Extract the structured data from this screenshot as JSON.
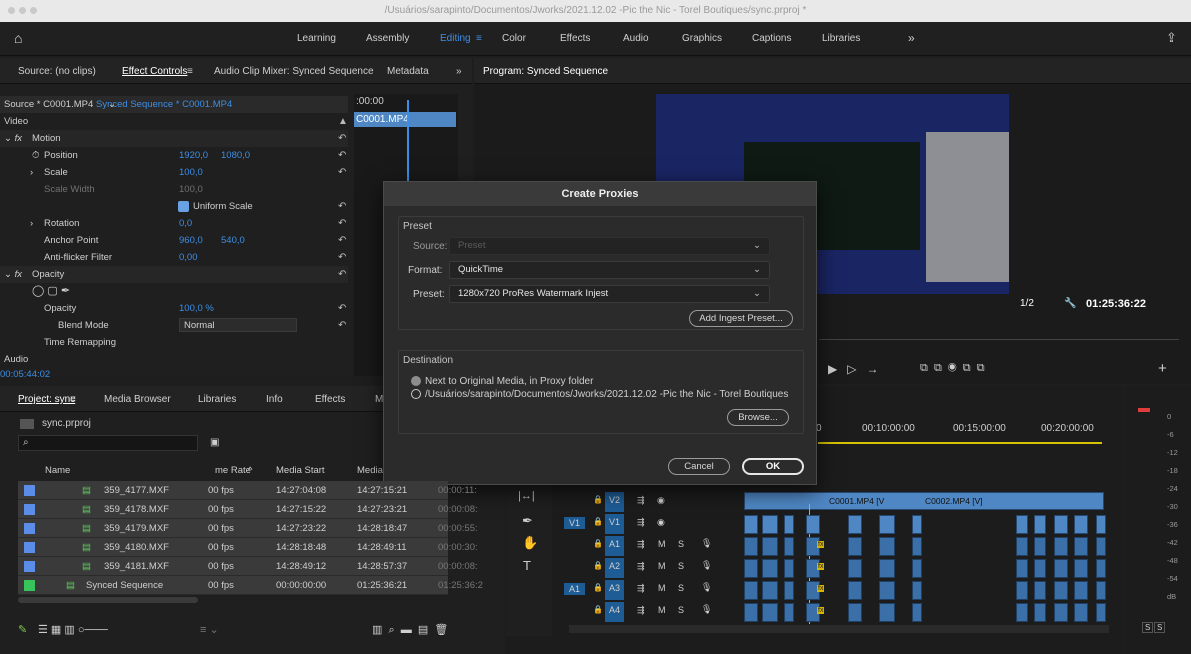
{
  "window": {
    "title": "/Usuários/sarapinto/Documentos/Jworks/2021.12.02 -Pic the Nic - Torel Boutiques/sync.prproj *"
  },
  "workspaces": {
    "items": [
      "Learning",
      "Assembly",
      "Editing",
      "Color",
      "Effects",
      "Audio",
      "Graphics",
      "Captions",
      "Libraries"
    ],
    "active": "Editing",
    "more": "»"
  },
  "source_panel": {
    "tabs": [
      "Source: (no clips)",
      "Effect Controls",
      "Audio Clip Mixer: Synced Sequence",
      "Metadata"
    ],
    "menu_icon": "≡",
    "more": "»"
  },
  "effect_controls": {
    "source_label": "Source * C0001.MP4",
    "sequence_label": "Synced Sequence * C0001.MP4",
    "timecode_ruler": ":00:00",
    "clip_name": "C0001.MP4",
    "section_video": "Video",
    "fx_motion": "Motion",
    "position_label": "Position",
    "position_x": "1920,0",
    "position_y": "1080,0",
    "scale_label": "Scale",
    "scale_value": "100,0",
    "scale_width_label": "Scale Width",
    "scale_width_value": "100,0",
    "uniform_scale": "Uniform Scale",
    "rotation_label": "Rotation",
    "rotation_value": "0,0",
    "anchor_label": "Anchor Point",
    "anchor_x": "960,0",
    "anchor_y": "540,0",
    "antiflicker_label": "Anti-flicker Filter",
    "antiflicker_value": "0,00",
    "fx_opacity": "Opacity",
    "opacity_label": "Opacity",
    "opacity_value": "100,0 %",
    "blend_label": "Blend Mode",
    "blend_value": "Normal",
    "time_remap": "Time Remapping",
    "section_audio": "Audio",
    "current_time": "00:05:44:02"
  },
  "program": {
    "title": "Program: Synced Sequence",
    "resolution": "1/2",
    "duration": "01:25:36:22"
  },
  "project": {
    "tabs": [
      "Project: sync",
      "Media Browser",
      "Libraries",
      "Info",
      "Effects",
      "M"
    ],
    "filename": "sync.prproj",
    "columns": [
      "Name",
      "me Rate",
      "Media Start",
      "Media"
    ],
    "rows": [
      {
        "name": "359_4177.MXF",
        "rate": "00 fps",
        "start": "14:27:04:08",
        "end": "14:27:15:21",
        "dur": "00:00:11:"
      },
      {
        "name": "359_4178.MXF",
        "rate": "00 fps",
        "start": "14:27:15:22",
        "end": "14:27:23:21",
        "dur": "00:00:08:"
      },
      {
        "name": "359_4179.MXF",
        "rate": "00 fps",
        "start": "14:27:23:22",
        "end": "14:28:18:47",
        "dur": "00:00:55:"
      },
      {
        "name": "359_4180.MXF",
        "rate": "00 fps",
        "start": "14:28:18:48",
        "end": "14:28:49:11",
        "dur": "00:00:30:"
      },
      {
        "name": "359_4181.MXF",
        "rate": "00 fps",
        "start": "14:28:49:12",
        "end": "14:28:57:37",
        "dur": "00:00:08:"
      },
      {
        "name": "Synced Sequence",
        "rate": "00 fps",
        "start": "00:00:00:00",
        "end": "01:25:36:21",
        "dur": "01:25:36:2"
      }
    ]
  },
  "timeline": {
    "ruler": [
      "00:10:00:00",
      "00:15:00:00",
      "00:20:00:00"
    ],
    "ruler_prefix": "0",
    "tracks": [
      {
        "name": "V2",
        "src": ""
      },
      {
        "name": "V1",
        "src": "V1"
      },
      {
        "name": "A1",
        "src": ""
      },
      {
        "name": "A2",
        "src": ""
      },
      {
        "name": "A3",
        "src": "A1"
      },
      {
        "name": "A4",
        "src": ""
      }
    ],
    "clip1": "C0001.MP4 [V",
    "clip2": "C0002.MP4 [V]",
    "fx_badge": "fx",
    "m_label": "M",
    "s_label": "S"
  },
  "meter": {
    "ticks": [
      "0",
      "-6",
      "-12",
      "-18",
      "-24",
      "-30",
      "-36",
      "-42",
      "-48",
      "-54",
      "dB"
    ],
    "solo": [
      "S",
      "S"
    ]
  },
  "dialog": {
    "title": "Create Proxies",
    "preset_group": "Preset",
    "source_label": "Source:",
    "source_value": "Preset",
    "format_label": "Format:",
    "format_value": "QuickTime",
    "preset_label": "Preset:",
    "preset_value": "1280x720 ProRes Watermark Injest",
    "add_ingest": "Add Ingest Preset...",
    "dest_group": "Destination",
    "opt_next": "Next to Original Media, in Proxy folder",
    "opt_path": "/Usuários/sarapinto/Documentos/Jworks/2021.12.02 -Pic the Nic - Torel Boutiques",
    "browse": "Browse...",
    "cancel": "Cancel",
    "ok": "OK"
  }
}
